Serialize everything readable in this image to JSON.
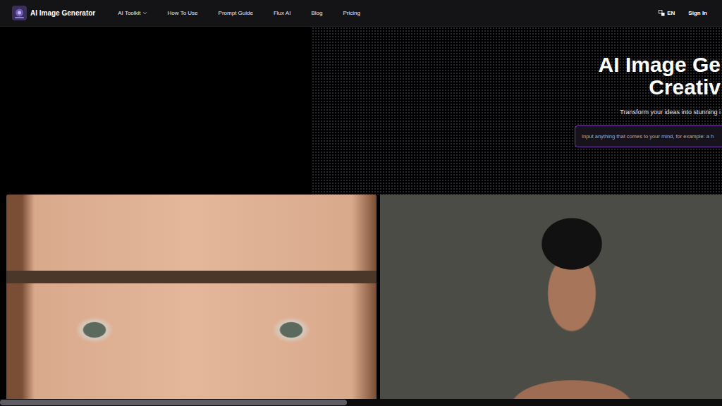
{
  "header": {
    "brand": "AI Image Generator",
    "nav": [
      {
        "label": "AI Toolkit",
        "kind": "menu"
      },
      {
        "label": "How To Use",
        "kind": "link"
      },
      {
        "label": "Prompt Guide",
        "kind": "link"
      },
      {
        "label": "Flux AI",
        "kind": "link"
      },
      {
        "label": "Blog",
        "kind": "link"
      },
      {
        "label": "Pricing",
        "kind": "link"
      }
    ],
    "language": "EN",
    "sign_in": "Sign In"
  },
  "hero": {
    "title_lines": [
      "AI Image Ge",
      "Creativ"
    ],
    "subtitle": "Transform your ideas into stunning i",
    "prompt": {
      "placeholder": "Input anything that comes to your mind, for example: a h"
    }
  },
  "scrollbar": {
    "level": 0.48
  }
}
